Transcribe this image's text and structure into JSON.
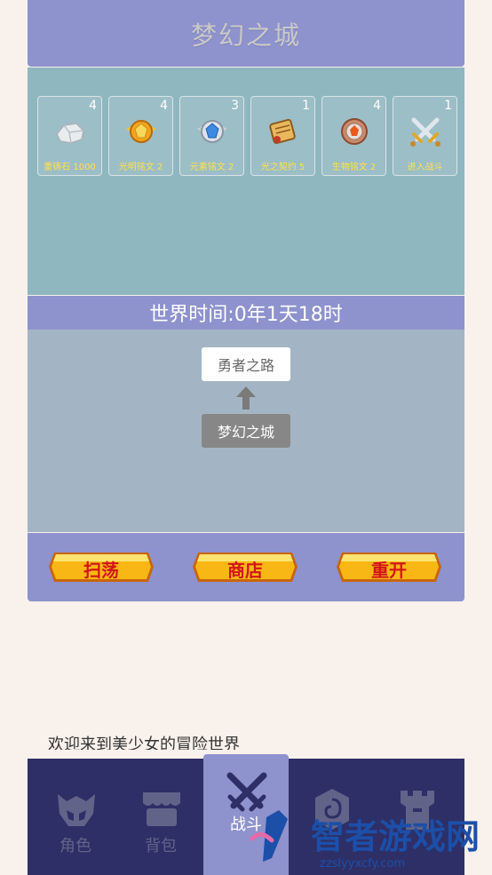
{
  "header": {
    "title": "梦幻之城"
  },
  "inventory": [
    {
      "count": "4",
      "label": "重铸石 1000",
      "icon": "silver-ore-icon"
    },
    {
      "count": "4",
      "label": "光明铭文 2",
      "icon": "light-rune-icon"
    },
    {
      "count": "3",
      "label": "元素铭文 2",
      "icon": "element-rune-icon"
    },
    {
      "count": "1",
      "label": "光之契约 5",
      "icon": "light-scroll-icon"
    },
    {
      "count": "4",
      "label": "生物铭文 2",
      "icon": "bio-rune-icon"
    },
    {
      "count": "1",
      "label": "进入战斗",
      "icon": "crossed-swords-icon"
    }
  ],
  "world_time": "世界时间:0年1天18时",
  "map": {
    "next_stage": "勇者之路",
    "current_stage": "梦幻之城"
  },
  "actions": {
    "sweep": "扫荡",
    "shop": "商店",
    "restart": "重开"
  },
  "welcome": "欢迎来到美少女的冒险世界",
  "tabs": [
    {
      "label": "角色",
      "icon": "helmet-icon"
    },
    {
      "label": "背包",
      "icon": "shop-bag-icon"
    },
    {
      "label": "战斗",
      "icon": "swords-icon"
    },
    {
      "label": "",
      "icon": "rune-stone-icon"
    },
    {
      "label": "",
      "icon": "castle-icon"
    }
  ],
  "watermark": {
    "main": "智者游戏网",
    "sub": "zzslyyxcfy.com"
  },
  "colors": {
    "panel": "#8e92cd",
    "inventory_bg": "#8fb7c0",
    "map_bg": "#a3b5c4",
    "tabbar": "#2e2f66",
    "gold": "#f6b915"
  }
}
